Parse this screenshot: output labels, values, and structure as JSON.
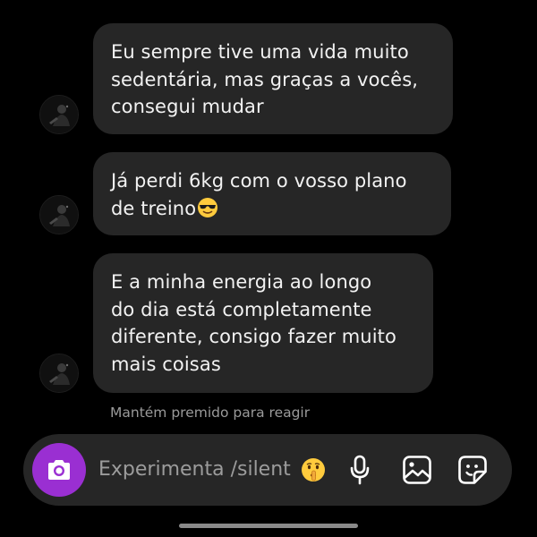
{
  "thread": {
    "messages": [
      {
        "lines": [
          "Eu sempre tive uma vida muito",
          "sedentária, mas graças a vocês,",
          "consegui mudar"
        ],
        "emoji": ""
      },
      {
        "lines": [
          "Já perdi 6kg com o vosso plano",
          "de treino"
        ],
        "emoji": "smiling-face-with-sunglasses"
      },
      {
        "lines": [
          "E a minha energia ao longo",
          "do dia está completamente",
          "diferente, consigo fazer muito",
          "mais coisas"
        ],
        "emoji": ""
      }
    ],
    "reaction_hint": "Mantém premido para reagir"
  },
  "composer": {
    "placeholder": "Experimenta /silent",
    "placeholder_emoji": "shushing-face",
    "camera_icon": "camera-icon",
    "mic_icon": "microphone-icon",
    "gallery_icon": "gallery-icon",
    "sticker_icon": "sticker-icon",
    "accent_color": "#9a2fd2"
  },
  "colors": {
    "background": "#000000",
    "bubble": "#262626",
    "text": "#f2f2f2",
    "muted": "#9a9a9a"
  }
}
